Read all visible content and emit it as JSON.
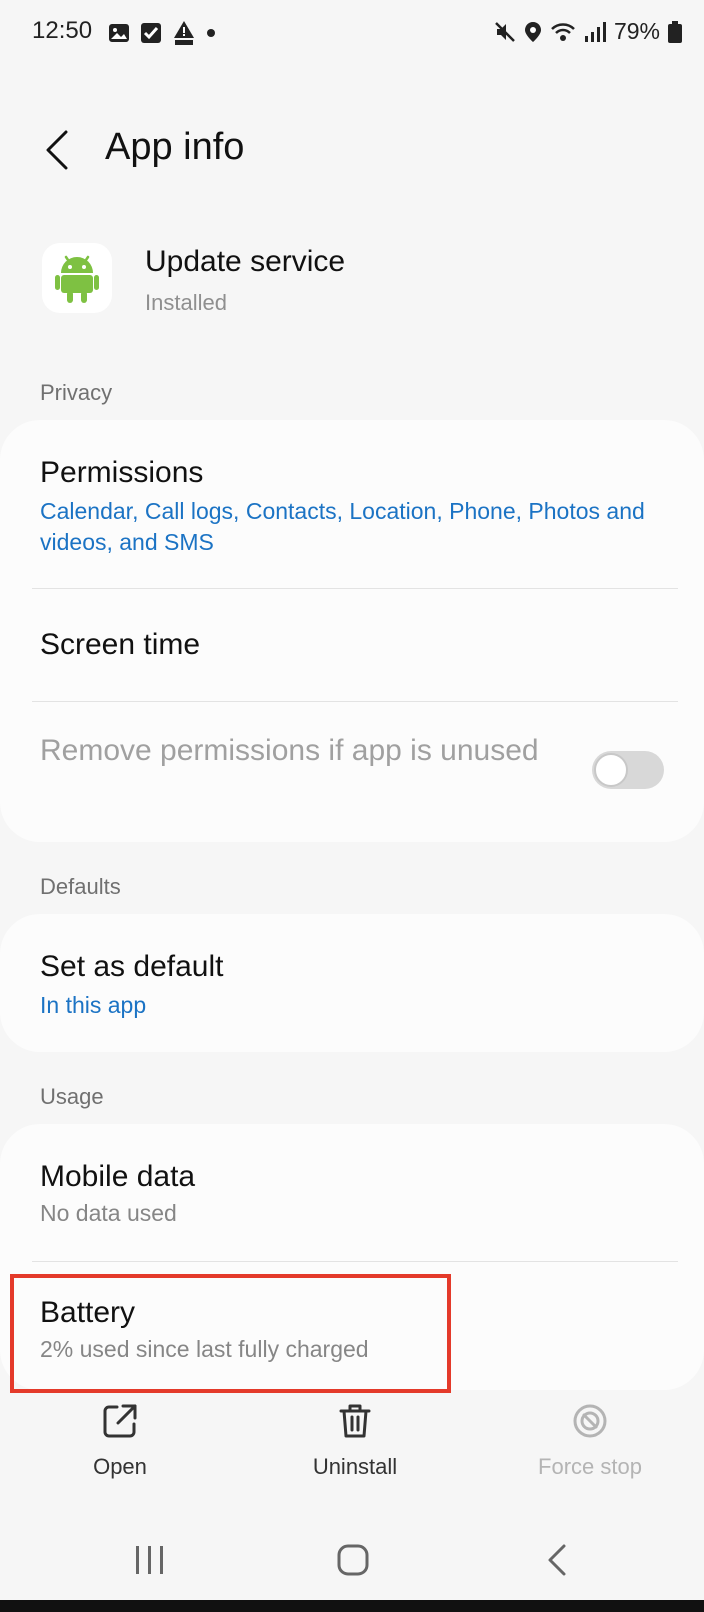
{
  "status_bar": {
    "time": "12:50",
    "battery_percent": "79%",
    "left_icons": [
      "gallery-icon",
      "checkbox-icon",
      "weather-alert-icon",
      "dot-icon"
    ],
    "right_icons": [
      "mute-icon",
      "location-icon",
      "wifi-icon",
      "signal-icon",
      "battery-icon"
    ]
  },
  "header": {
    "title": "App info"
  },
  "app": {
    "name": "Update service",
    "status": "Installed",
    "icon": "android-icon",
    "icon_color": "#7ec142"
  },
  "sections": {
    "privacy": "Privacy",
    "defaults": "Defaults",
    "usage": "Usage"
  },
  "privacy_items": {
    "permissions_title": "Permissions",
    "permissions_sub": "Calendar, Call logs, Contacts, Location, Phone, Photos and videos, and SMS",
    "screen_time_title": "Screen time",
    "remove_permissions_title": "Remove permissions if app is unused",
    "remove_permissions_enabled": false
  },
  "defaults_items": {
    "set_default_title": "Set as default",
    "set_default_sub": "In this app"
  },
  "usage_items": {
    "mobile_data_title": "Mobile data",
    "mobile_data_sub": "No data used",
    "battery_title": "Battery",
    "battery_sub": "2% used since last fully charged"
  },
  "actions": {
    "open": "Open",
    "uninstall": "Uninstall",
    "force_stop": "Force stop"
  },
  "colors": {
    "accent_blue": "#1b73c4",
    "highlight_red": "#e43a2a",
    "background": "#f6f6f6"
  }
}
